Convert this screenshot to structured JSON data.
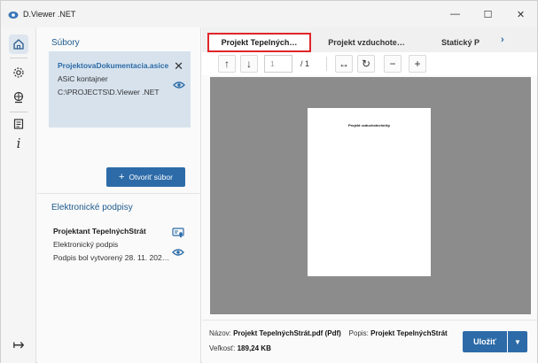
{
  "window": {
    "title": "D.Viewer .NET",
    "controls": {
      "minimize": "—",
      "maximize": "☐",
      "close": "✕"
    }
  },
  "rail": {
    "items": [
      "home-icon",
      "settings-icon",
      "globe-icon",
      "document-icon",
      "info-icon"
    ],
    "collapse": "↦"
  },
  "files": {
    "heading": "Súbory",
    "card": {
      "name": "ProjektovaDokumentacia.asice",
      "type": "ASiC kontajner",
      "path": "C:\\PROJECTS\\D.Viewer .NET"
    },
    "open_button": "Otvoriť súbor"
  },
  "signatures": {
    "heading": "Elektronické podpisy",
    "item": {
      "signer": "Projektant TepelnýchStrát",
      "type": "Elektronický podpis",
      "created": "Podpis bol vytvorený 28. 11. 202…"
    }
  },
  "tabs": [
    {
      "label": "Projekt Tepelných…"
    },
    {
      "label": "Projekt vzduchote…"
    },
    {
      "label": "Statický P"
    }
  ],
  "toolbar": {
    "page_placeholder": "1",
    "page_total": "/ 1"
  },
  "document": {
    "page_title": "Projekt vzduchotechniky"
  },
  "footer": {
    "name_label": "Názov:",
    "name_value": "Projekt TepelnýchStrát.pdf (Pdf)",
    "desc_label": "Popis:",
    "desc_value": "Projekt TepelnýchStrát",
    "size_label": "Veľkosť:",
    "size_value": "189,24 KB",
    "save": "Uložiť"
  },
  "colors": {
    "accent": "#2d6ba8",
    "highlight": "#e0262a",
    "card": "#d7e2ed"
  }
}
